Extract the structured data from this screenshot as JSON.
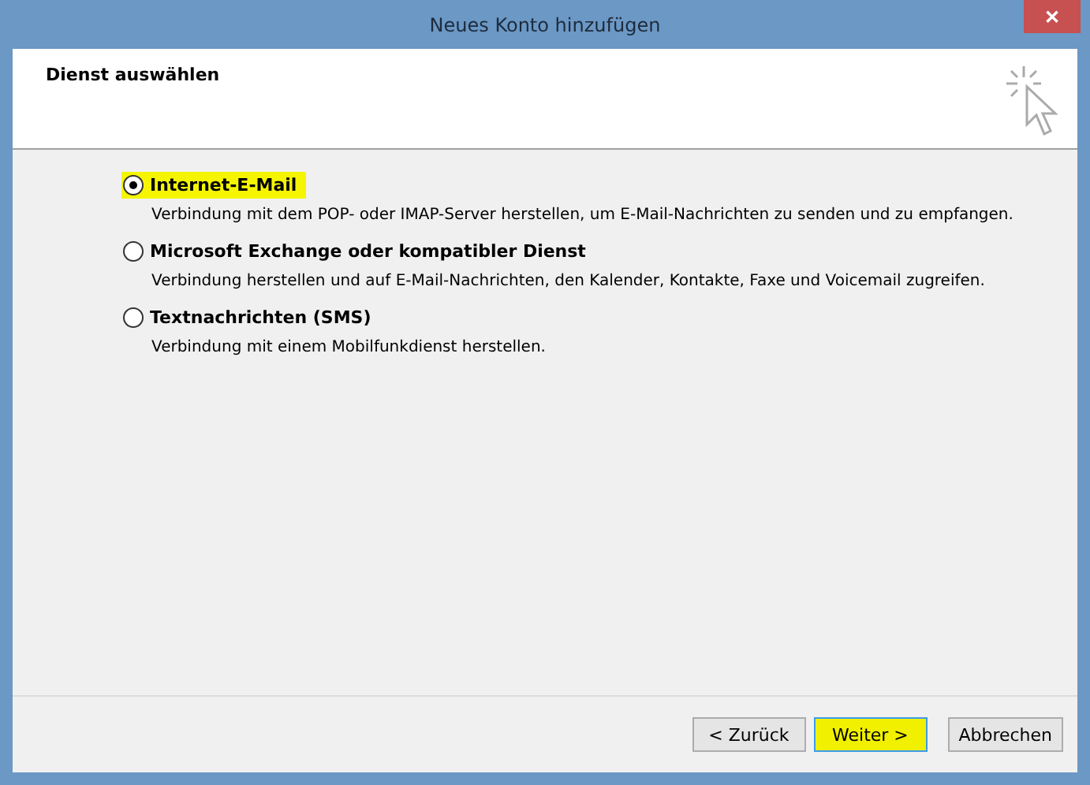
{
  "window": {
    "title": "Neues Konto hinzufügen",
    "close": "✕"
  },
  "header": {
    "title": "Dienst auswählen"
  },
  "options": [
    {
      "label": "Internet-E-Mail",
      "description": "Verbindung mit dem POP- oder IMAP-Server herstellen, um E-Mail-Nachrichten zu senden und zu empfangen.",
      "selected": true,
      "highlighted": true
    },
    {
      "label": "Microsoft Exchange oder kompatibler Dienst",
      "description": "Verbindung herstellen und auf E-Mail-Nachrichten, den Kalender, Kontakte, Faxe und Voicemail zugreifen.",
      "selected": false,
      "highlighted": false
    },
    {
      "label": "Textnachrichten (SMS)",
      "description": "Verbindung mit einem Mobilfunkdienst herstellen.",
      "selected": false,
      "highlighted": false
    }
  ],
  "buttons": [
    {
      "label": "< Zurück",
      "highlighted": false
    },
    {
      "label": "Weiter >",
      "highlighted": true
    },
    {
      "label": "Abbrechen",
      "highlighted": false
    }
  ]
}
